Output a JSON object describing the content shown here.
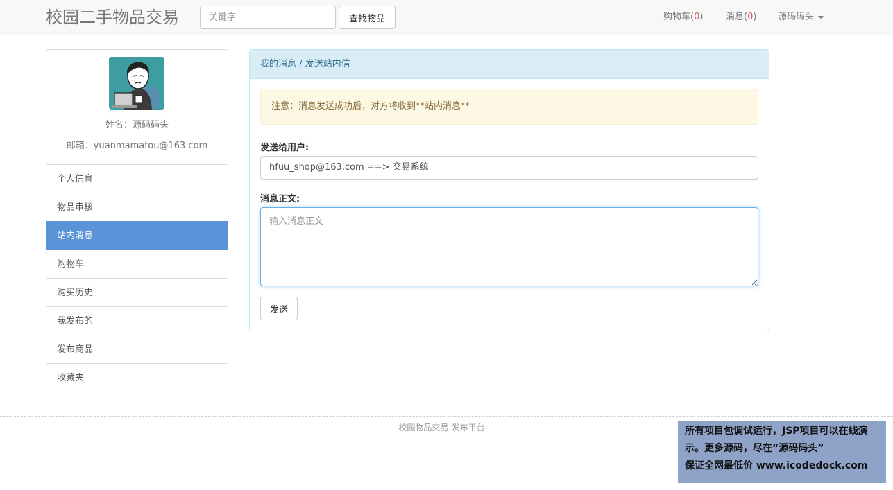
{
  "navbar": {
    "brand": "校园二手物品交易",
    "search_placeholder": "关键字",
    "search_button": "查找物品",
    "cart_label": "购物车(",
    "cart_count": "0",
    "messages_label": "消息(",
    "messages_count": "0",
    "close_paren": ")",
    "user_menu": "源码码头"
  },
  "profile": {
    "name_line": "姓名：源码码头",
    "email_line": "邮箱：yuanmamatou@163.com"
  },
  "sidebar": {
    "items": [
      {
        "label": "个人信息"
      },
      {
        "label": "物品审核"
      },
      {
        "label": "站内消息"
      },
      {
        "label": "购物车"
      },
      {
        "label": "购买历史"
      },
      {
        "label": "我发布的"
      },
      {
        "label": "发布商品"
      },
      {
        "label": "收藏夹"
      }
    ],
    "active_index": 2
  },
  "panel": {
    "heading": "我的消息 / 发送站内信",
    "notice": "注意：消息发送成功后，对方将收到**站内消息**",
    "recipient_label": "发送给用户:",
    "recipient_value": "hfuu_shop@163.com ==> 交易系统",
    "body_label": "消息正文:",
    "body_placeholder": "输入消息正文",
    "send_button": "发送"
  },
  "footer": {
    "text": "校园物品交易-发布平台"
  },
  "watermark": {
    "line1": "所有项目包调试运行，JSP项目可以在线演",
    "line2": "示。更多源码，尽在“源码码头”",
    "line3": "保证全网最低价 www.icodedock.com"
  },
  "colors": {
    "active_item": "#5b93d9",
    "panel_heading_bg": "#d9edf7",
    "alert_bg": "#fcf8e3",
    "count_red": "#d9534f"
  }
}
